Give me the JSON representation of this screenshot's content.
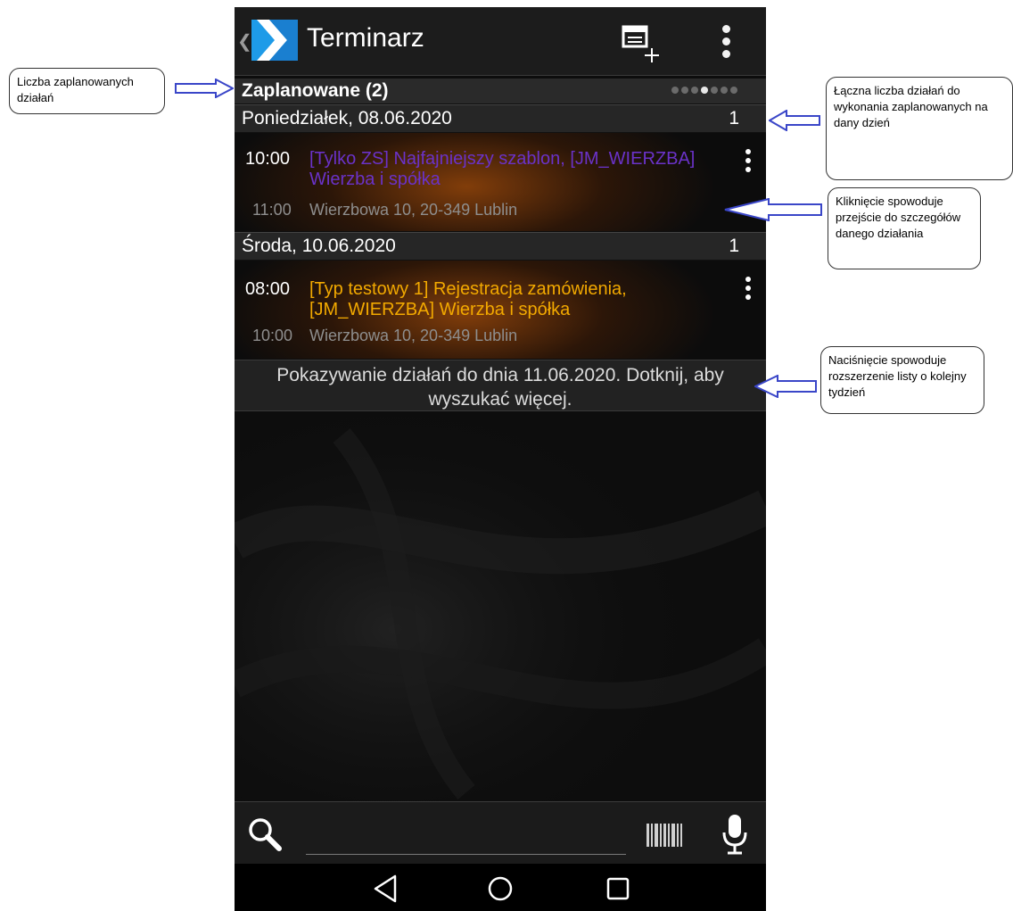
{
  "app": {
    "title": "Terminarz"
  },
  "section": {
    "title": "Zaplanowane (2)"
  },
  "days": [
    {
      "label": "Poniedziałek, 08.06.2020",
      "count": "1",
      "event": {
        "time": "10:00",
        "title": "[Tylko ZS] Najfajniejszy szablon, [JM_WIERZBA] Wierzba i spółka",
        "end_time": "11:00",
        "address": "Wierzbowa 10, 20-349 Lublin",
        "title_color": "#6a32c8"
      }
    },
    {
      "label": "Środa, 10.06.2020",
      "count": "1",
      "event": {
        "time": "08:00",
        "title": "[Typ testowy 1] Rejestracja zamówienia, [JM_WIERZBA] Wierzba i spółka",
        "end_time": "10:00",
        "address": "Wierzbowa 10, 20-349 Lublin",
        "title_color": "#f2a900"
      }
    }
  ],
  "more": {
    "text": "Pokazywanie działań do dnia 11.06.2020. Dotknij, aby wyszukać więcej."
  },
  "search": {
    "value": ""
  },
  "pager": {
    "total": 7,
    "active_index": 3
  },
  "annotations": {
    "planned_count": "Liczba zaplanowanych działań",
    "day_total": "Łączna liczba działań do wykonania zaplanowanych na dany dzień",
    "click_details": "Kliknięcie spowoduje przejście do szczegółów danego działania",
    "extend_list": "Naciśnięcie spowoduje rozszerzenie listy o kolejny tydzień"
  },
  "icons": {
    "logo": "app-logo-icon",
    "add": "add-event-icon",
    "menu": "overflow-menu-icon",
    "search": "search-icon",
    "barcode": "barcode-icon",
    "mic": "microphone-icon",
    "back": "nav-back-icon",
    "home": "nav-home-icon",
    "recents": "nav-recents-icon"
  },
  "colors": {
    "annotation_arrow": "#3a46c8",
    "logo_blue": "#1e9be8"
  }
}
